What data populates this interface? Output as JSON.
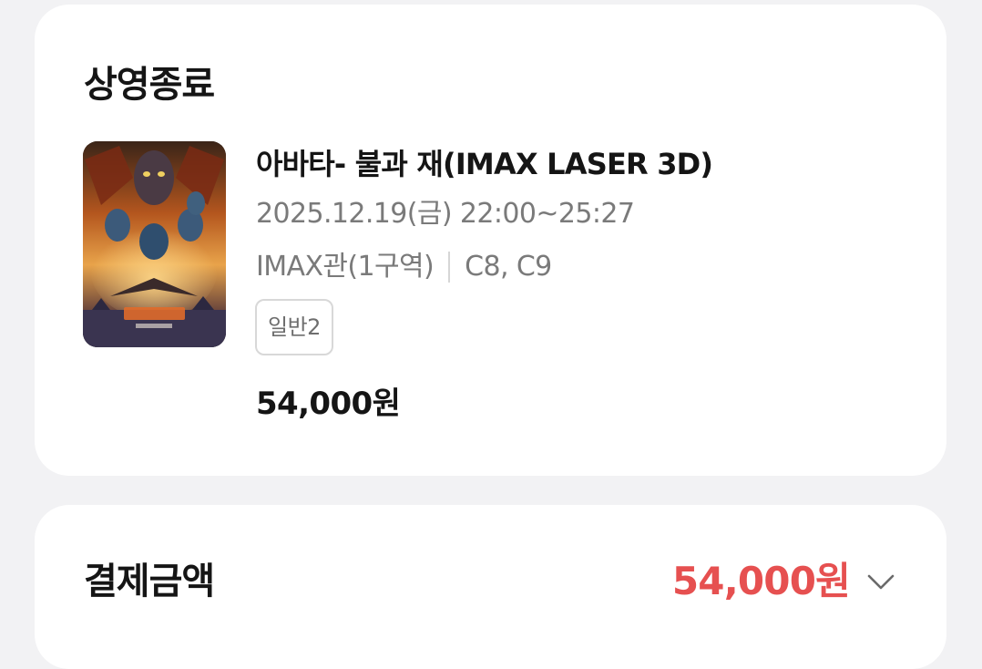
{
  "ticket": {
    "status": "상영종료",
    "poster_icon": "movie-poster",
    "movie_title": "아바타- 불과 재(IMAX LASER 3D)",
    "showtime": "2025.12.19(금) 22:00~25:27",
    "hall": "IMAX관(1구역)",
    "seats": "C8, C9",
    "audience_badge": "일반2",
    "price": "54,000원"
  },
  "payment": {
    "label": "결제금액",
    "amount": "54,000원",
    "amount_color": "#e65050",
    "toggle_icon": "chevron-down-icon"
  }
}
